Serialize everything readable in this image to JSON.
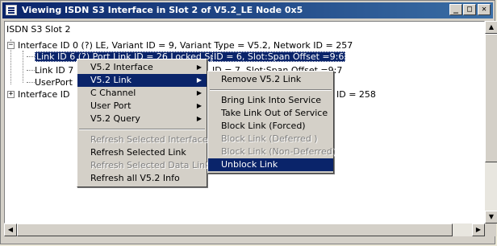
{
  "window": {
    "title": "Viewing ISDN S3 Interface in Slot  2 of V5.2_LE Node 0x5",
    "minimize": "_",
    "maximize": "□",
    "close": "✕"
  },
  "tree": {
    "root": "ISDN S3 Slot 2",
    "interface0": "Interface ID 0 (?)  LE,  Variant ID = 9, Variant Type = V5.2,  Network ID = 257",
    "link_selected_prefix": "Link ID 6",
    "link_selected_suffix": "ID = 6,  Slot:Span Offset =9:6",
    "link_selected_mid": "(?)  Port Link ID = 26  Locked Sp",
    "link7_prefix": "Link ID 7",
    "link7_suffix": "ID = 7,  Slot:Span Offset =9:7",
    "userport": "UserPort",
    "interface1_prefix": "Interface ID",
    "interface1_suffix": "ID = 258",
    "expand_minus": "−",
    "expand_plus": "+"
  },
  "context_menu": {
    "items": [
      {
        "label": "V5.2 Interface",
        "submenu": true,
        "disabled": false
      },
      {
        "label": "V5.2 Link",
        "submenu": true,
        "disabled": false,
        "active": true
      },
      {
        "label": "C Channel",
        "submenu": true,
        "disabled": false
      },
      {
        "label": "User Port",
        "submenu": true,
        "disabled": false
      },
      {
        "label": "V5.2 Query",
        "submenu": true,
        "disabled": false
      },
      {
        "label": "Refresh Selected Interface",
        "disabled": true
      },
      {
        "label": "Refresh Selected Link",
        "disabled": false
      },
      {
        "label": "Refresh Selected Data Link",
        "disabled": true
      },
      {
        "label": "Refresh all V5.2 Info",
        "disabled": false
      }
    ],
    "arrow": "▶"
  },
  "submenu": {
    "items": [
      {
        "label": "Remove  V5.2 Link",
        "disabled": false
      },
      {
        "label": "Bring Link Into Service",
        "disabled": false
      },
      {
        "label": "Take Link Out of Service",
        "disabled": false
      },
      {
        "label": "Block Link (Forced)",
        "disabled": false
      },
      {
        "label": "Block Link (Deferred )",
        "disabled": true
      },
      {
        "label": "Block Link (Non-Deferred)",
        "disabled": true
      },
      {
        "label": "Unblock Link",
        "disabled": false,
        "highlighted": true
      }
    ]
  },
  "scroll": {
    "up": "▲",
    "down": "▼",
    "left": "◀",
    "right": "▶"
  },
  "colors": {
    "selection": "#0a246a",
    "title_start": "#0a246a",
    "title_end": "#3a6ea5"
  }
}
